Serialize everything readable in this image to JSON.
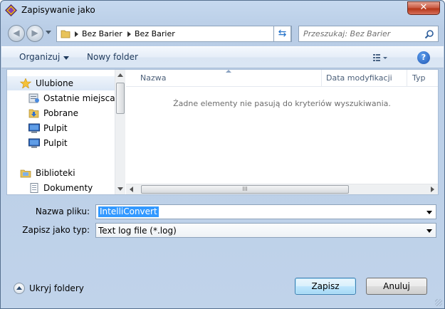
{
  "window": {
    "title": "Zapisywanie jako",
    "close_label": "✕"
  },
  "navbar": {
    "back_glyph": "◀",
    "forward_glyph": "▶",
    "breadcrumbs": [
      "Bez Barier",
      "Bez Barier"
    ],
    "refresh_glyph": "⇆",
    "search_placeholder": "Przeszukaj: Bez Barier"
  },
  "toolbar": {
    "organize_label": "Organizuj",
    "new_folder_label": "Nowy folder",
    "help_glyph": "?"
  },
  "sidebar": {
    "items": [
      {
        "label": "Ulubione",
        "icon": "star-icon"
      },
      {
        "label": "Ostatnie miejsca",
        "icon": "recent-places-icon"
      },
      {
        "label": "Pobrane",
        "icon": "downloads-folder-icon"
      },
      {
        "label": "Pulpit",
        "icon": "desktop-icon"
      },
      {
        "label": "Pulpit",
        "icon": "desktop-icon"
      },
      {
        "label": "Biblioteki",
        "icon": "libraries-icon"
      },
      {
        "label": "Dokumenty",
        "icon": "documents-icon"
      }
    ]
  },
  "file_list": {
    "columns": [
      "Nazwa",
      "Data modyfikacji",
      "Typ"
    ],
    "empty_message": "Żadne elementy nie pasują do kryteriów wyszukiwania.",
    "hscroll_grip": "III"
  },
  "form": {
    "file_name_label": "Nazwa pliku:",
    "file_name_value": "IntelliConvert",
    "save_type_label": "Zapisz jako typ:",
    "save_type_value": "Text log file (*.log)"
  },
  "footer": {
    "hide_folders_label": "Ukryj foldery",
    "save_button": "Zapisz",
    "cancel_button": "Anuluj"
  },
  "colors": {
    "accent": "#3399ff",
    "close": "#c7563e"
  }
}
